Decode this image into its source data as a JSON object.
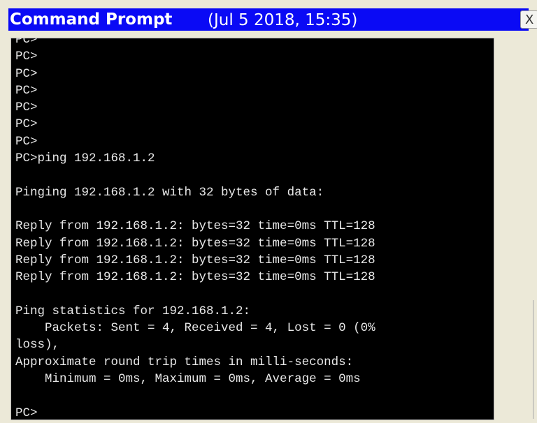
{
  "window": {
    "title": "Command Prompt",
    "timestamp": "(Jul 5 2018, 15:35)",
    "close_glyph": "X"
  },
  "terminal": {
    "lines": [
      "PC>",
      "PC>",
      "PC>",
      "PC>",
      "PC>",
      "PC>",
      "PC>",
      "PC>ping 192.168.1.2",
      "",
      "Pinging 192.168.1.2 with 32 bytes of data:",
      "",
      "Reply from 192.168.1.2: bytes=32 time=0ms TTL=128",
      "Reply from 192.168.1.2: bytes=32 time=0ms TTL=128",
      "Reply from 192.168.1.2: bytes=32 time=0ms TTL=128",
      "Reply from 192.168.1.2: bytes=32 time=0ms TTL=128",
      "",
      "Ping statistics for 192.168.1.2:",
      "    Packets: Sent = 4, Received = 4, Lost = 0 (0%",
      "loss),",
      "Approximate round trip times in milli-seconds:",
      "    Minimum = 0ms, Maximum = 0ms, Average = 0ms",
      "",
      "PC>"
    ]
  }
}
